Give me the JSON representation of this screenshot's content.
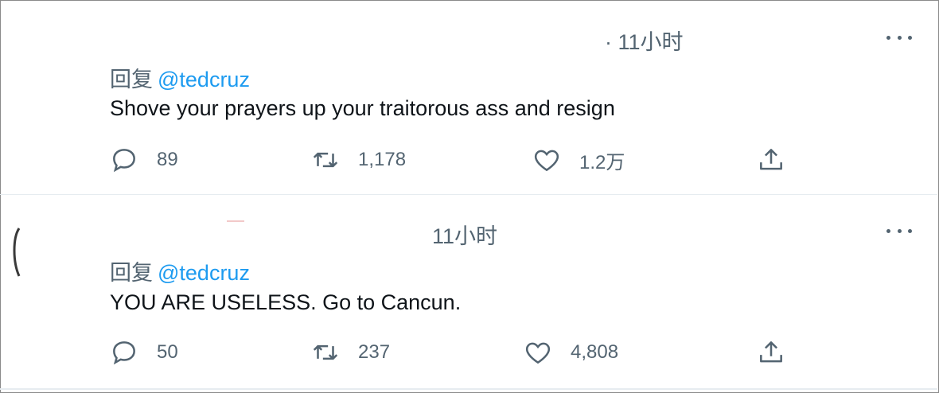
{
  "tweets": [
    {
      "time": "· 11小时",
      "reply_prefix": "回复",
      "reply_handle": "@tedcruz",
      "text": "Shove your prayers up your traitorous ass and resign",
      "replies": "89",
      "retweets": "1,178",
      "likes": "1.2万"
    },
    {
      "time": "11小时",
      "reply_prefix": "回复",
      "reply_handle": "@tedcruz",
      "text": "YOU ARE USELESS. Go to Cancun.",
      "replies": "50",
      "retweets": "237",
      "likes": "4,808"
    }
  ],
  "icons": {
    "reply": "reply-icon",
    "retweet": "retweet-icon",
    "like": "heart-icon",
    "share": "share-icon",
    "more": "more-options-icon"
  },
  "colors": {
    "link": "#1d9bf0",
    "muted": "#536471",
    "text": "#0f1419"
  }
}
